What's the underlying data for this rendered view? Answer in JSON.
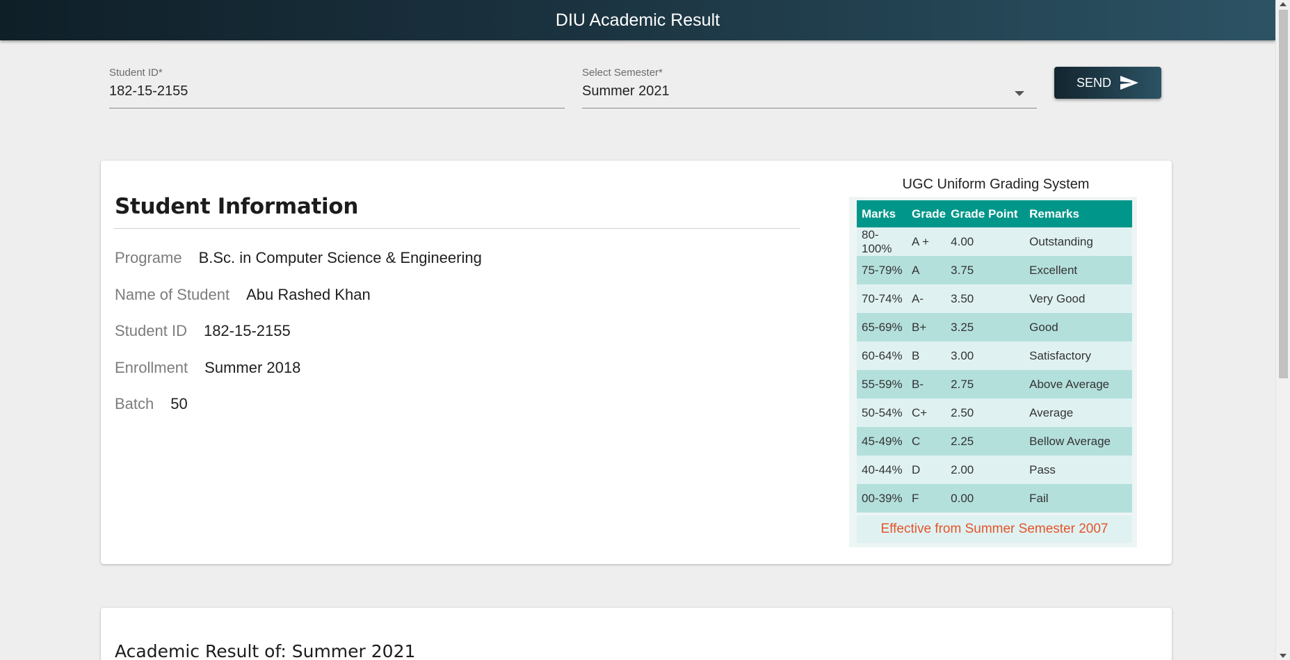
{
  "app": {
    "title": "DIU Academic Result"
  },
  "form": {
    "student_id_label": "Student ID*",
    "student_id_value": "182-15-2155",
    "semester_label": "Select Semester*",
    "semester_value": "Summer 2021",
    "send_label": "SEND",
    "send_icon": "send-icon"
  },
  "student_info": {
    "title": "Student Information",
    "rows": [
      {
        "label": "Programe",
        "value": "B.Sc. in Computer Science & Engineering"
      },
      {
        "label": "Name of Student",
        "value": "Abu Rashed Khan"
      },
      {
        "label": "Student ID",
        "value": "182-15-2155"
      },
      {
        "label": "Enrollment",
        "value": "Summer 2018"
      },
      {
        "label": "Batch",
        "value": "50"
      }
    ]
  },
  "grading": {
    "caption": "UGC Uniform Grading System",
    "headers": [
      "Marks",
      "Grade",
      "Grade Point",
      "Remarks"
    ],
    "rows": [
      [
        "80-100%",
        "A +",
        "4.00",
        "Outstanding"
      ],
      [
        "75-79%",
        "A",
        "3.75",
        "Excellent"
      ],
      [
        "70-74%",
        "A-",
        "3.50",
        "Very Good"
      ],
      [
        "65-69%",
        "B+",
        "3.25",
        "Good"
      ],
      [
        "60-64%",
        "B",
        "3.00",
        "Satisfactory"
      ],
      [
        "55-59%",
        "B-",
        "2.75",
        "Above Average"
      ],
      [
        "50-54%",
        "C+",
        "2.50",
        "Average"
      ],
      [
        "45-49%",
        "C",
        "2.25",
        "Bellow Average"
      ],
      [
        "40-44%",
        "D",
        "2.00",
        "Pass"
      ],
      [
        "00-39%",
        "F",
        "0.00",
        "Fail"
      ]
    ],
    "footer": "Effective from Summer Semester 2007",
    "header_color": "#00978a",
    "footer_color": "#e4532a"
  },
  "result": {
    "title": "Academic Result of: Summer 2021"
  }
}
